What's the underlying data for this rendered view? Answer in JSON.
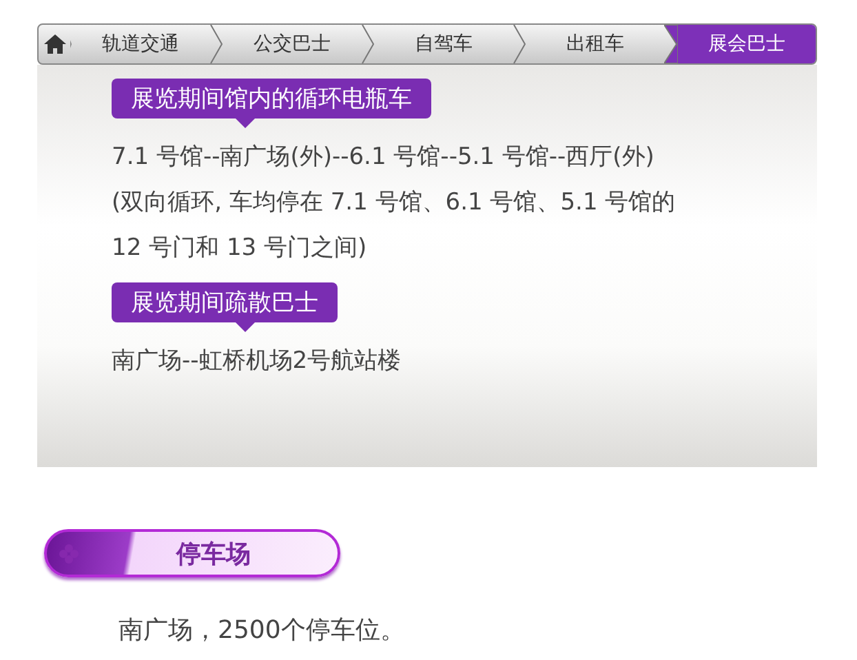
{
  "nav": {
    "tabs": [
      {
        "label": "轨道交通",
        "selected": false
      },
      {
        "label": "公交巴士",
        "selected": false
      },
      {
        "label": "自驾车",
        "selected": false
      },
      {
        "label": "出租车",
        "selected": false
      },
      {
        "label": "展会巴士",
        "selected": true
      }
    ]
  },
  "sections": [
    {
      "heading": "展览期间馆内的循环电瓶车",
      "lines": [
        "7.1 号馆--南广场(外)--6.1 号馆--5.1 号馆--西厅(外)",
        "(双向循环, 车均停在 7.1 号馆、6.1 号馆、5.1 号馆的",
        "12 号门和 13 号门之间)"
      ]
    },
    {
      "heading": "展览期间疏散巴士",
      "lines": [
        "南广场--虹桥机场2号航站楼"
      ]
    }
  ],
  "parking": {
    "heading": "停车场",
    "text": "南广场，2500个停车位。"
  }
}
